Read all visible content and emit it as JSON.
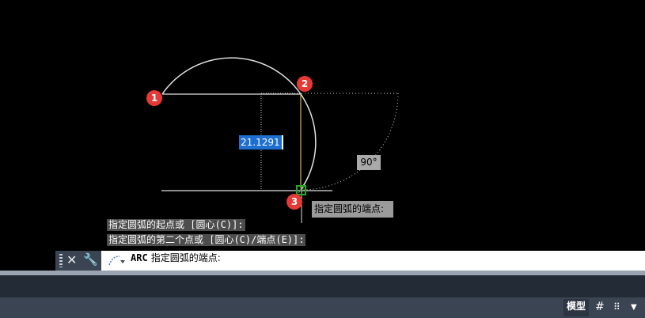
{
  "drawing": {
    "markers": [
      "1",
      "2",
      "3"
    ],
    "dimension_value": "21.1291",
    "angle_label": "90°",
    "point_prompt": "指定圆弧的端点:"
  },
  "history": {
    "lines": [
      "指定圆弧的起点或 [圆心(C)]:",
      "指定圆弧的第二个点或 [圆心(C)/端点(E)]:"
    ]
  },
  "command_line": {
    "command": "ARC",
    "prompt": "指定圆弧的端点:",
    "close_icon": "close-icon",
    "customize_icon": "wrench-icon",
    "recent_icon": "arc-command-icon"
  },
  "status_bar": {
    "model_label": "模型",
    "icons": [
      "grid-icon",
      "snap-icon",
      "dropdown-icon"
    ]
  },
  "colors": {
    "canvas": "#000000",
    "marker": "#e53935",
    "selection": "#1e6fd0",
    "snap": "#22aa22",
    "cursor": "#f2d94a"
  }
}
